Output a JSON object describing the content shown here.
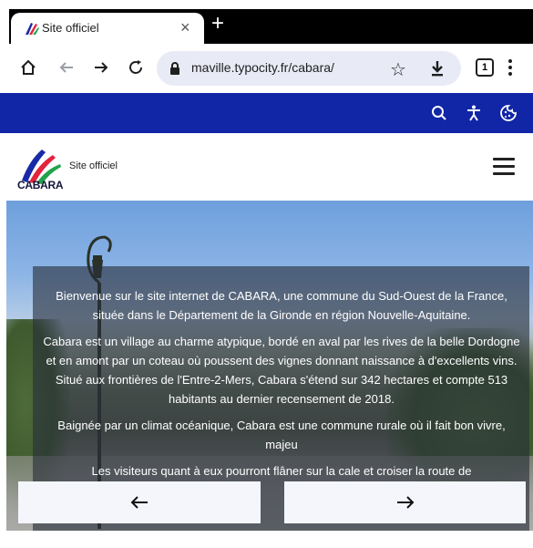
{
  "browser": {
    "tab": {
      "title": "Site officiel",
      "favicon": "cabara-logo-icon",
      "close": "×"
    },
    "new_tab": "+",
    "toolbar": {
      "url": "maville.typocity.fr/cabara/",
      "tabs_count": "1",
      "icons": [
        "home-icon",
        "back-icon",
        "forward-icon",
        "reload-icon",
        "lock-icon",
        "star-icon",
        "download-icon",
        "tabs-icon",
        "menu-icon"
      ]
    }
  },
  "utility_bar": {
    "color": "#1026a6",
    "icons": [
      "search-icon",
      "accessibility-icon",
      "cookie-icon"
    ]
  },
  "header": {
    "logo_text": "CABARA",
    "site_label": "Site officiel"
  },
  "hero": {
    "paragraphs": [
      "Bienvenue sur le site internet de CABARA, une commune du Sud-Ouest de la France, située dans le Département de la Gironde en région Nouvelle-Aquitaine.",
      "Cabara est un village au charme atypique, bordé en aval par les rives de la belle Dordogne et en amont par un coteau où poussent des vignes donnant naissance à d'excellents vins. Situé aux frontières de l'Entre-2-Mers, Cabara s'étend sur 342 hectares et compte 513 habitants au dernier recensement de 2018.",
      "Baignée par un climat océanique, Cabara est une commune rurale où il fait bon vivre, majeu",
      "Les visiteurs quant à eux pourront flâner sur la cale et croiser la route de"
    ]
  },
  "nav": {
    "prev": "left-arrow-icon",
    "next": "right-arrow-icon"
  }
}
